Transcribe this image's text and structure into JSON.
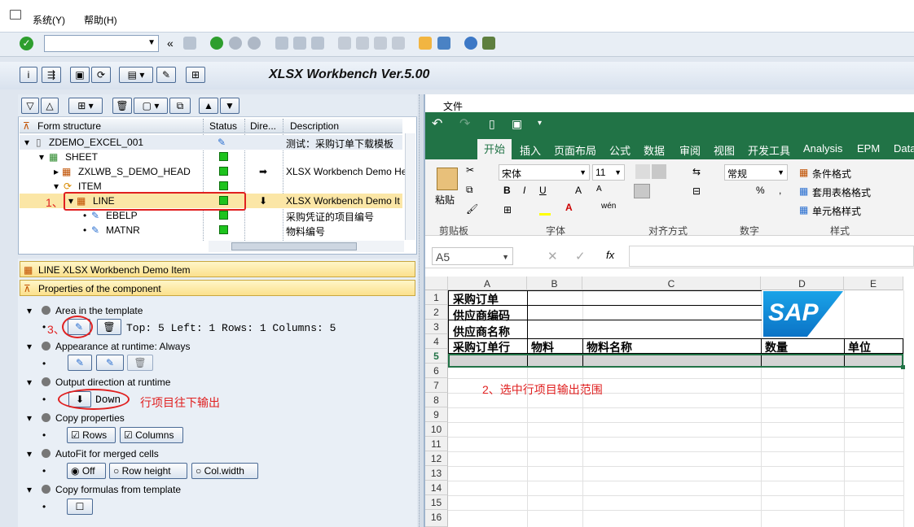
{
  "menu": {
    "system": "系统(Y)",
    "help": "帮助(H)"
  },
  "app_title": "XLSX Workbench Ver.5.00",
  "tree": {
    "headers": [
      "Form structure",
      "Status",
      "Dire...",
      "Description"
    ],
    "rows": [
      {
        "label": "ZDEMO_EXCEL_001",
        "desc": "测试：采购订单下载模板"
      },
      {
        "label": "SHEET",
        "desc": ""
      },
      {
        "label": "ZXLWB_S_DEMO_HEAD",
        "desc": "XLSX Workbench Demo He"
      },
      {
        "label": "ITEM",
        "desc": ""
      },
      {
        "label": "LINE",
        "desc": "XLSX Workbench Demo It"
      },
      {
        "label": "EBELP",
        "desc": "采购凭证的项目编号"
      },
      {
        "label": "MATNR",
        "desc": "物料编号"
      }
    ]
  },
  "panel": {
    "component_title": "LINE  XLSX Workbench Demo Item",
    "properties_title": "Properties of the component",
    "area_label": "Area in the template",
    "area_value": "Top: 5 Left: 1 Rows: 1 Columns: 5",
    "appearance_label": "Appearance at runtime: Always",
    "output_label": "Output direction at runtime",
    "output_value": "Down",
    "copy_label": "Copy properties",
    "copy_rows": "Rows",
    "copy_cols": "Columns",
    "autofit_label": "AutoFit for merged cells",
    "autofit_off": "Off",
    "autofit_rowh": "Row height",
    "autofit_colw": "Col.width",
    "formulas_label": "Copy formulas from template"
  },
  "annotations": {
    "a1": "1、",
    "a2": "2、选中行项目输出范围",
    "a3": "3、",
    "a_down": "行项目往下输出"
  },
  "excel": {
    "file_menu": "文件",
    "tabs": [
      "开始",
      "插入",
      "页面布局",
      "公式",
      "数据",
      "审阅",
      "视图",
      "开发工具",
      "Analysis",
      "EPM",
      "Data"
    ],
    "font_name": "宋体",
    "font_size": "11",
    "number_format": "常规",
    "paste": "粘贴",
    "cond_format": "条件格式",
    "table_format": "套用表格格式",
    "cell_style": "单元格样式",
    "groups": [
      "剪贴板",
      "字体",
      "对齐方式",
      "数字",
      "样式"
    ],
    "name_box": "A5",
    "fx": "fx",
    "columns": [
      "A",
      "B",
      "C",
      "D",
      "E"
    ],
    "rows": [
      "1",
      "2",
      "3",
      "4",
      "5",
      "6",
      "7",
      "8",
      "9",
      "10",
      "11",
      "12",
      "13",
      "14",
      "15",
      "16"
    ],
    "cells": {
      "a1": "采购订单",
      "a2": "供应商编码",
      "a3": "供应商名称",
      "a4": "采购订单行",
      "b4": "物料",
      "c4": "物料名称",
      "d4": "数量",
      "e4": "单位"
    },
    "logo": "SAP"
  }
}
